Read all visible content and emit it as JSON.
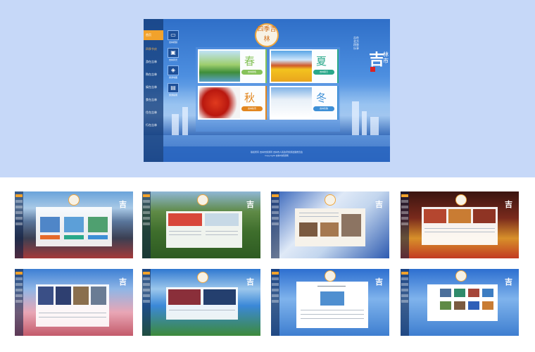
{
  "hero": {
    "sidebar": [
      {
        "label": "首页",
        "active": true
      },
      {
        "label": "四季节庆",
        "active": false
      },
      {
        "label": "游在吉林",
        "active": false
      },
      {
        "label": "购在吉林",
        "active": false
      },
      {
        "label": "娱在吉林",
        "active": false
      },
      {
        "label": "食在吉林",
        "active": false
      },
      {
        "label": "住在吉林",
        "active": false
      },
      {
        "label": "行在吉林",
        "active": false
      }
    ],
    "icons": [
      {
        "name": "tv-icon",
        "label": "吉林视频"
      },
      {
        "name": "image-icon",
        "label": "吉林风光"
      },
      {
        "name": "map-icon",
        "label": "旅游地图"
      },
      {
        "name": "book-icon",
        "label": "旅游指南"
      }
    ],
    "logo_text": "四季吉林",
    "seasons": [
      {
        "char": "春",
        "tag": "吉林春色",
        "color": "#86c25a",
        "tag_color": "#86c25a"
      },
      {
        "char": "夏",
        "tag": "吉林夏日",
        "color": "#2aa88a",
        "tag_color": "#2aa88a"
      },
      {
        "char": "秋",
        "tag": "吉林秋景",
        "color": "#e2861f",
        "tag_color": "#e2861f"
      },
      {
        "char": "冬",
        "tag": "吉林冬韵",
        "color": "#3d8fd6",
        "tag_color": "#3d8fd6"
      }
    ],
    "brand": {
      "big": "吉",
      "small": "林市",
      "slogan": "吉在北方 四季乐享"
    },
    "footer": [
      "版权所有 吉林市旅游局 吉林市人民政府旅游发展委员会",
      "Copyright 吉林市旅游网"
    ]
  },
  "thumbs": [
    {
      "name": "thumb-page-1",
      "theme": "sky"
    },
    {
      "name": "thumb-page-2",
      "theme": "green"
    },
    {
      "name": "thumb-page-3",
      "theme": "frost"
    },
    {
      "name": "thumb-page-4",
      "theme": "food"
    },
    {
      "name": "thumb-page-5",
      "theme": "blossom"
    },
    {
      "name": "thumb-page-6",
      "theme": "lake"
    },
    {
      "name": "thumb-page-7",
      "theme": "article"
    },
    {
      "name": "thumb-page-8",
      "theme": "gallery"
    }
  ]
}
